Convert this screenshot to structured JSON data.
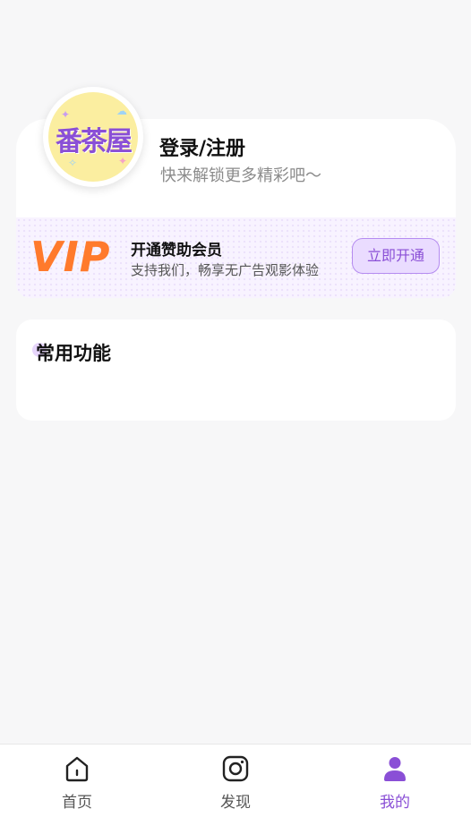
{
  "profile": {
    "avatar_text": "番茶屋",
    "login_title": "登录/注册",
    "login_subtitle": "快来解锁更多精彩吧～"
  },
  "vip": {
    "logo_text": "VIP",
    "title": "开通赞助会员",
    "description": "支持我们，畅享无广告观影体验",
    "button_label": "立即开通"
  },
  "functions": {
    "title": "常用功能"
  },
  "tabbar": {
    "tabs": [
      {
        "label": "首页",
        "icon": "home-icon",
        "active": false
      },
      {
        "label": "发现",
        "icon": "discover-icon",
        "active": false
      },
      {
        "label": "我的",
        "icon": "user-icon",
        "active": true
      }
    ]
  },
  "colors": {
    "accent": "#8a4fd6",
    "vip_orange": "#ff7a2c",
    "background": "#f7f7f8"
  }
}
